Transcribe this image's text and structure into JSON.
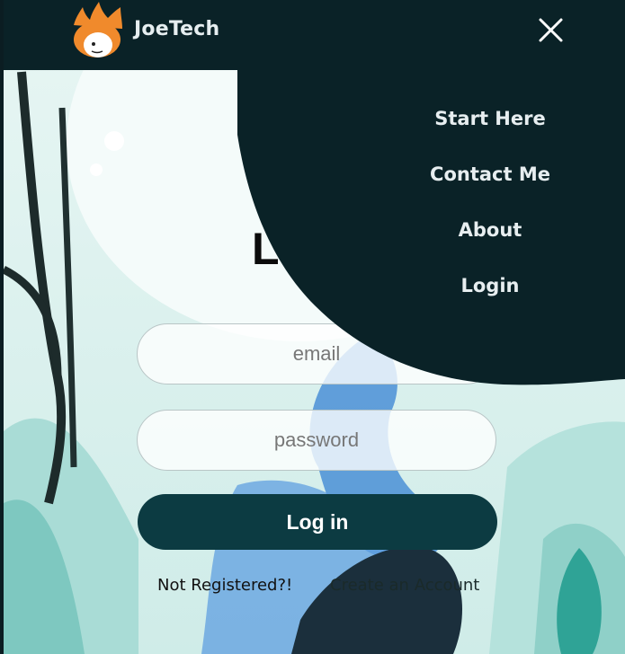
{
  "brand": {
    "name": "JoeTech"
  },
  "nav": {
    "close_icon": "close-icon",
    "items": [
      {
        "label": "Start Here"
      },
      {
        "label": "Contact Me"
      },
      {
        "label": "About"
      },
      {
        "label": "Login"
      }
    ]
  },
  "login": {
    "title": "Log in",
    "email_placeholder": "email",
    "password_placeholder": "password",
    "submit_label": "Log in",
    "not_registered": "Not Registered?!",
    "create_account": "Create an Account"
  },
  "colors": {
    "topbar": "#0a2227",
    "accent": "#0c3b42",
    "logo_flame": "#f08a2c"
  }
}
